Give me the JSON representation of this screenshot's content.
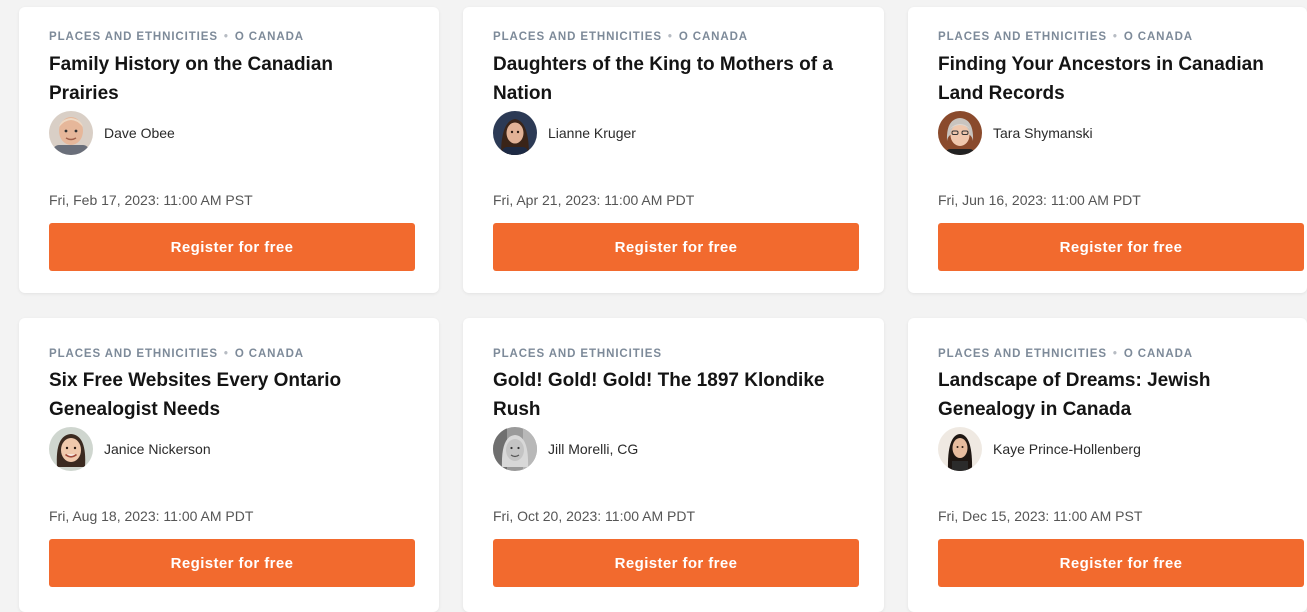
{
  "colors": {
    "accent": "#f26a2e",
    "category": "#7d8a99",
    "page_bg": "#f3f3f3",
    "card_bg": "#ffffff"
  },
  "cards": [
    {
      "category": "PLACES AND ETHNICITIES",
      "subcategory": "O CANADA",
      "title": "Family History on the Canadian Prairies",
      "author": "Dave Obee",
      "avatar_icon": "avatar-bald-man-icon",
      "date": "Fri, Feb 17, 2023: 11:00 AM PST",
      "button_label": "Register for free"
    },
    {
      "category": "PLACES AND ETHNICITIES",
      "subcategory": "O CANADA",
      "title": "Daughters of the King to Mothers of a Nation",
      "author": "Lianne Kruger",
      "avatar_icon": "avatar-woman-dark-hair-icon",
      "date": "Fri, Apr 21, 2023: 11:00 AM PDT",
      "button_label": "Register for free"
    },
    {
      "category": "PLACES AND ETHNICITIES",
      "subcategory": "O CANADA",
      "title": "Finding Your Ancestors in Canadian Land Records",
      "author": "Tara Shymanski",
      "avatar_icon": "avatar-woman-grey-hair-icon",
      "date": "Fri, Jun 16, 2023: 11:00 AM PDT",
      "button_label": "Register for free"
    },
    {
      "category": "PLACES AND ETHNICITIES",
      "subcategory": "O CANADA",
      "title": "Six Free Websites Every Ontario Genealogist Needs",
      "author": "Janice Nickerson",
      "avatar_icon": "avatar-woman-smiling-icon",
      "date": "Fri, Aug 18, 2023: 11:00 AM PDT",
      "button_label": "Register for free"
    },
    {
      "category": "PLACES AND ETHNICITIES",
      "subcategory": "",
      "title": "Gold! Gold! Gold! The 1897 Klondike Rush",
      "author": "Jill Morelli, CG",
      "avatar_icon": "avatar-woman-grey-photo-icon",
      "date": "Fri, Oct 20, 2023: 11:00 AM PDT",
      "button_label": "Register for free"
    },
    {
      "category": "PLACES AND ETHNICITIES",
      "subcategory": "O CANADA",
      "title": "Landscape of Dreams: Jewish Genealogy in Canada",
      "author": "Kaye Prince-Hollenberg",
      "avatar_icon": "avatar-woman-long-hair-icon",
      "date": "Fri, Dec 15, 2023: 11:00 AM PST",
      "button_label": "Register for free"
    }
  ]
}
